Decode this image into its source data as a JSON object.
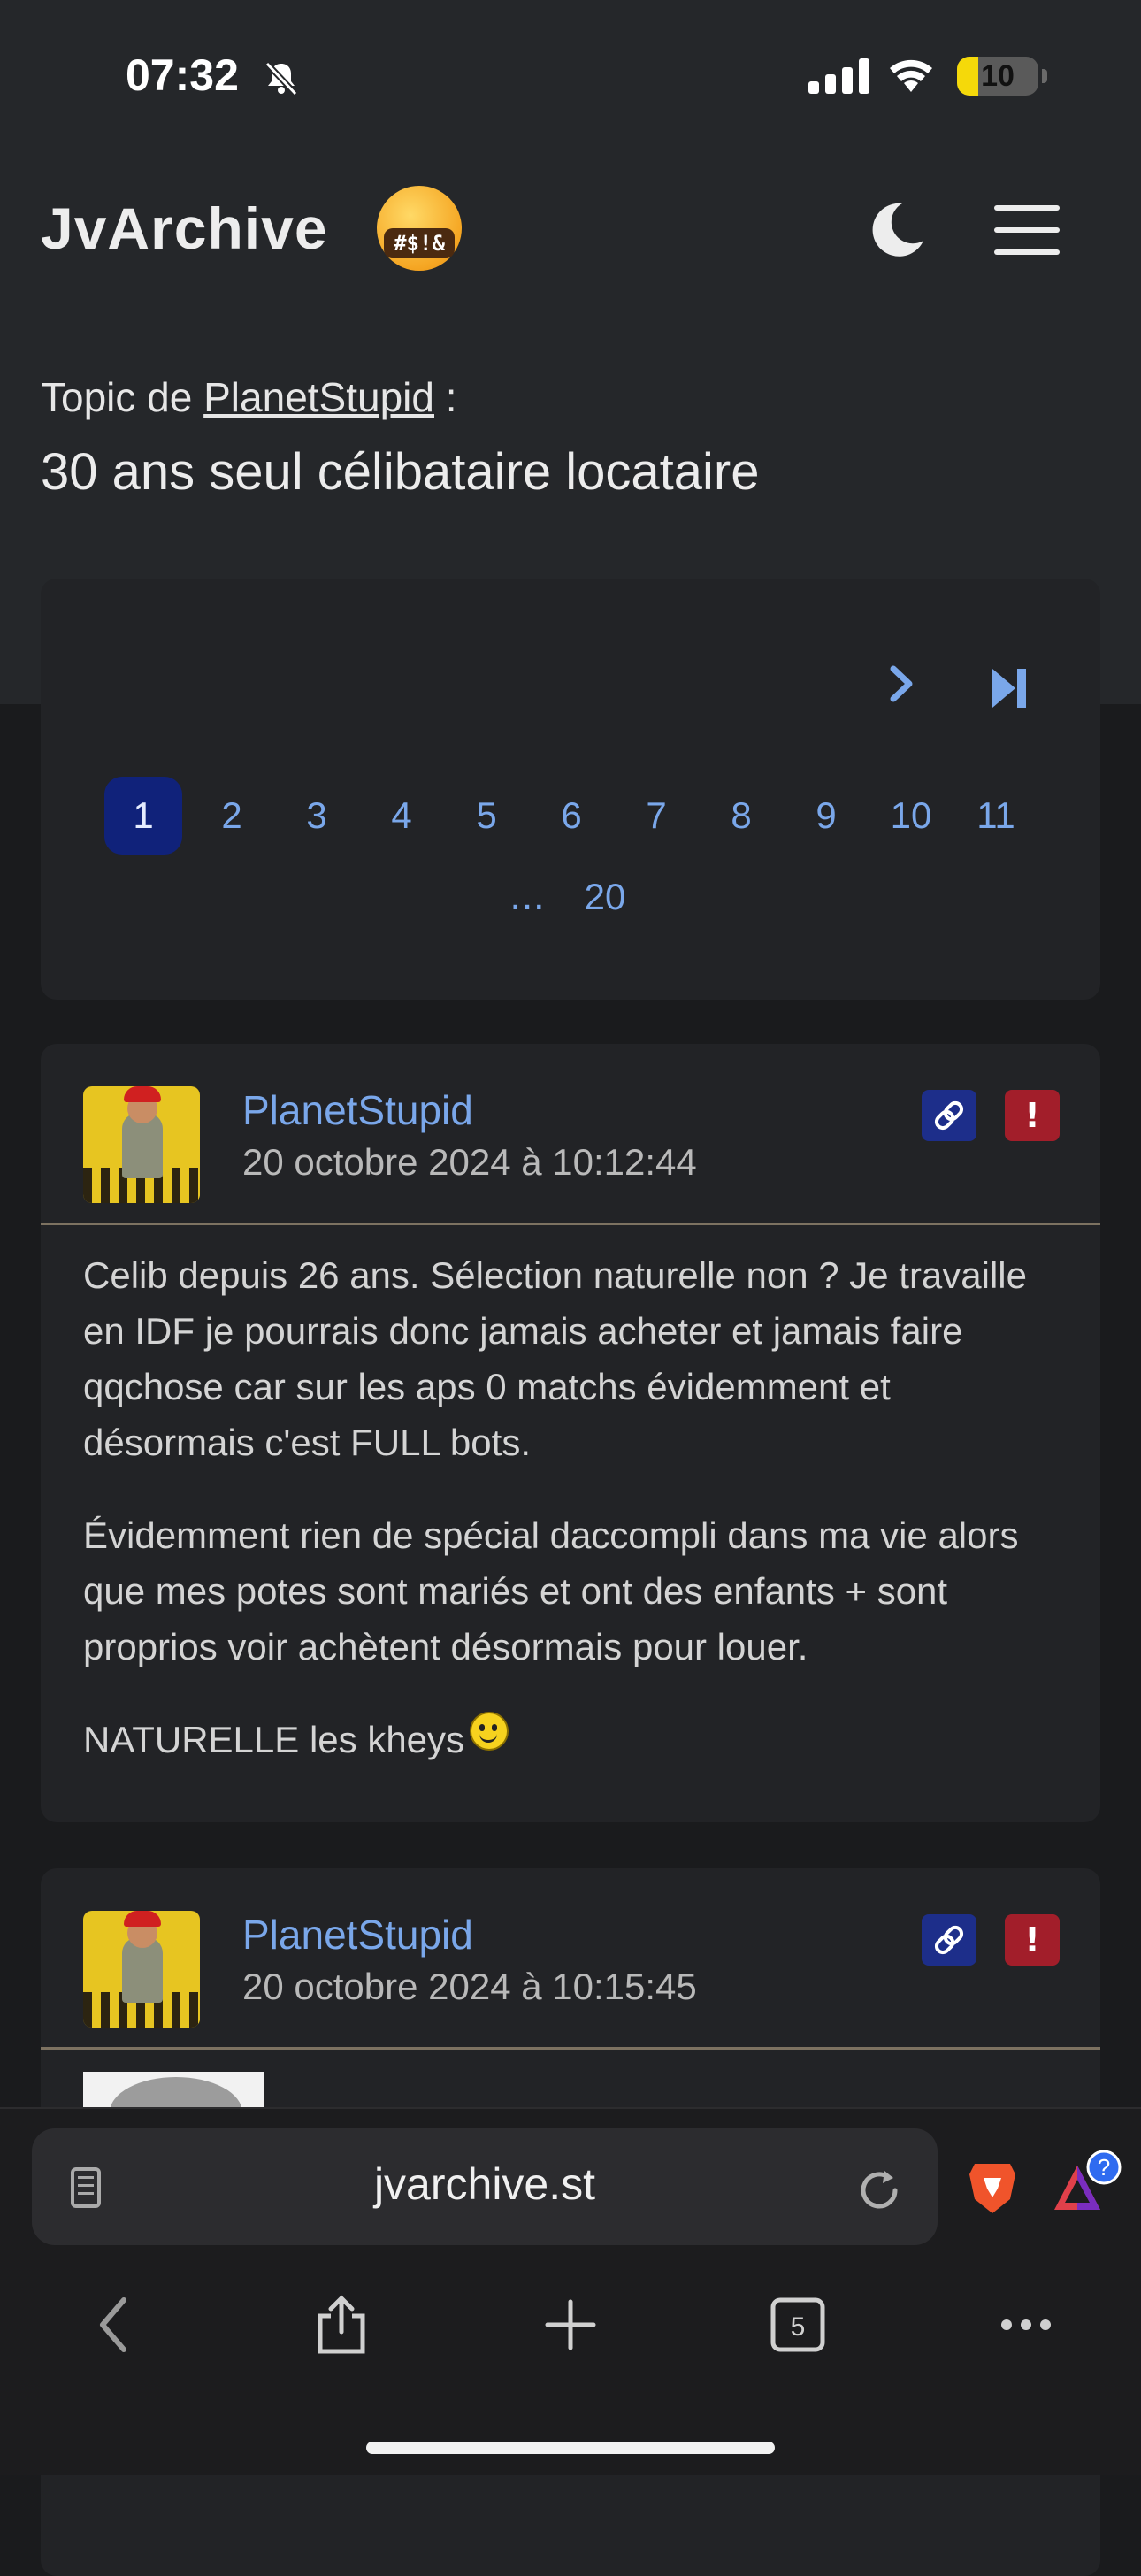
{
  "status_bar": {
    "time": "07:32",
    "battery": "10",
    "battery_level_percent": 10
  },
  "header": {
    "logo": "JvArchive",
    "logo_emoji_text": "#$!&"
  },
  "topic": {
    "prefix": "Topic de",
    "author": "PlanetStupid",
    "suffix": ":",
    "title": "30 ans seul célibataire locataire"
  },
  "pagination": {
    "row1": [
      "1",
      "2",
      "3",
      "4",
      "5",
      "6",
      "7",
      "8",
      "9",
      "10",
      "11"
    ],
    "active": "1",
    "ellipsis": "...",
    "last": "20"
  },
  "posts": [
    {
      "author": "PlanetStupid",
      "date": "20 octobre 2024 à 10:12:44",
      "paragraphs": [
        "Celib depuis 26 ans. Sélection naturelle non ? Je travaille en IDF je pourrais donc jamais acheter et jamais faire qqchose car sur les aps 0 matchs évidemment et désormais c'est FULL bots.",
        "Évidemment rien de spécial daccompli dans ma vie alors que mes potes sont mariés et ont des enfants + sont proprios voir achètent désormais pour louer.",
        "NATURELLE les kheys"
      ],
      "report_label": "!"
    },
    {
      "author": "PlanetStupid",
      "date": "20 octobre 2024 à 10:15:45",
      "report_label": "!"
    }
  ],
  "browser": {
    "url": "jvarchive.st",
    "tabs_count": "5",
    "rewards_badge": "?"
  }
}
